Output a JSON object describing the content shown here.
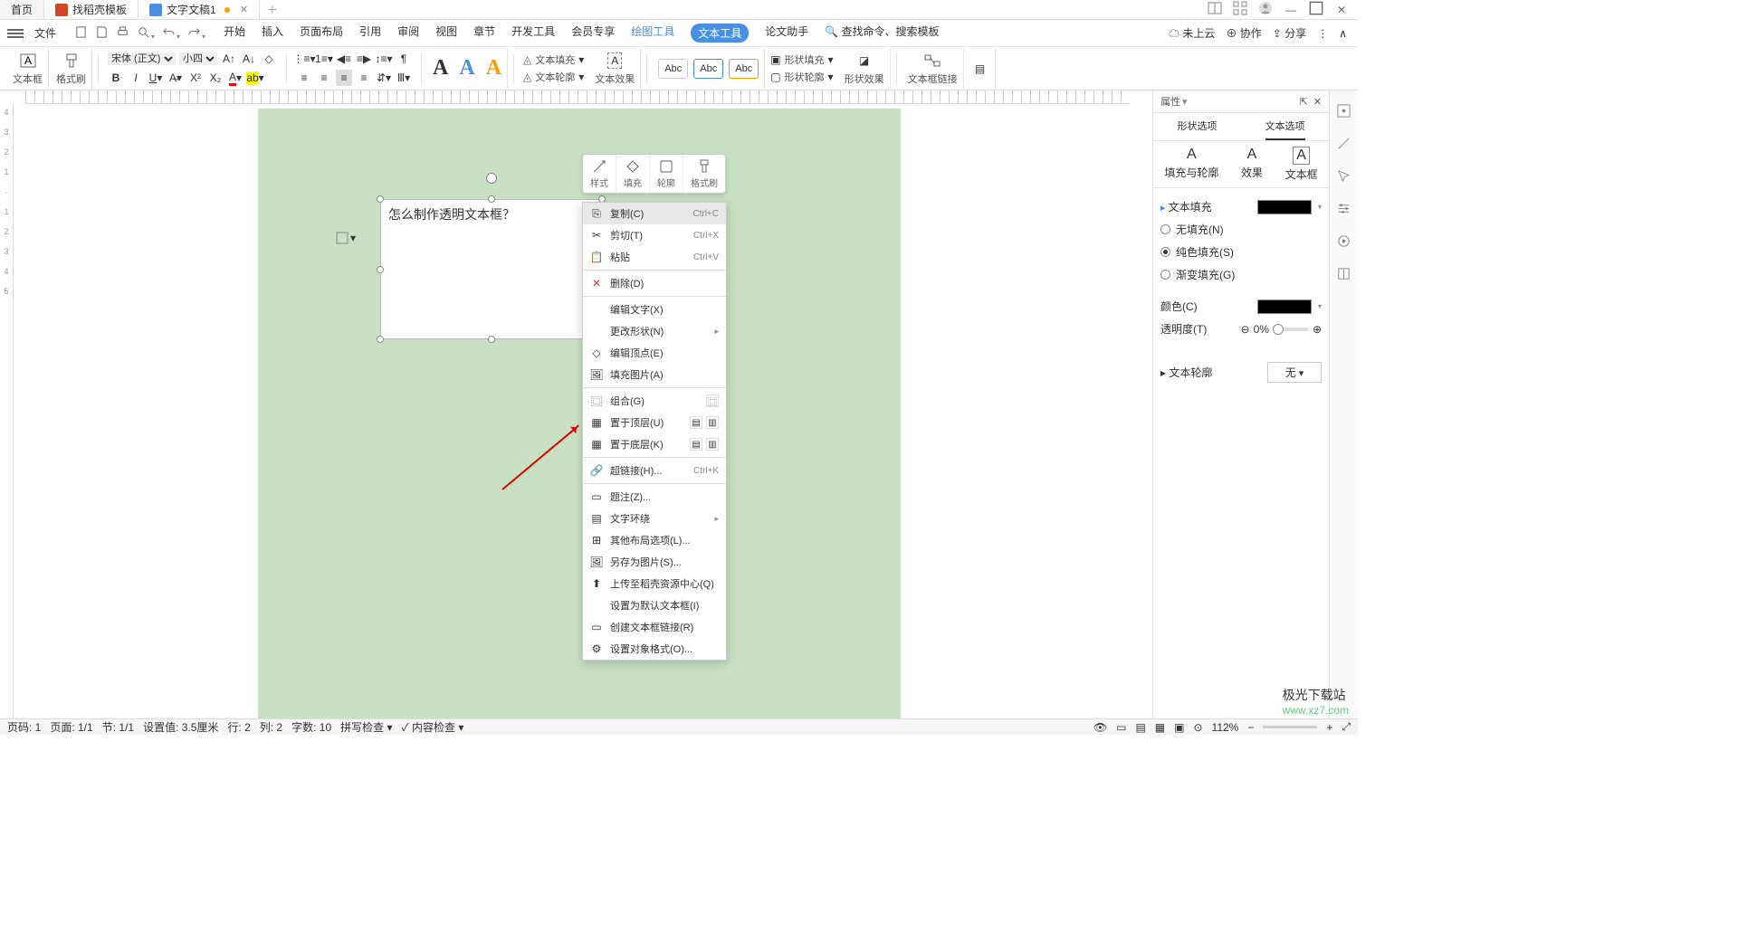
{
  "tabs": {
    "home": "首页",
    "docker": "找稻壳模板",
    "doc": "文字文稿1"
  },
  "menu": {
    "file": "文件",
    "items": [
      "开始",
      "插入",
      "页面布局",
      "引用",
      "审阅",
      "视图",
      "章节",
      "开发工具",
      "会员专享"
    ],
    "draw": "绘图工具",
    "text": "文本工具",
    "paper": "论文助手",
    "searchCmd": "查找命令、搜索模板",
    "notCloud": "未上云",
    "collab": "协作",
    "share": "分享"
  },
  "ribbon": {
    "textbox": "文本框",
    "format": "格式刷",
    "font": "宋体 (正文)",
    "size": "小四",
    "textFill": "文本填充",
    "textOutline": "文本轮廓",
    "textEffects": "文本效果",
    "shapeFill": "形状填充",
    "shapeOutline": "形状轮廓",
    "shapeEffects": "形状效果",
    "textboxLink": "文本框链接"
  },
  "mini": {
    "style": "样式",
    "fill": "填充",
    "outline": "轮廓",
    "fmt": "格式刷"
  },
  "textbox": {
    "content": "怎么制作透明文本框？"
  },
  "context": {
    "copy": "复制(C)",
    "copyKey": "Ctrl+C",
    "cut": "剪切(T)",
    "cutKey": "Ctrl+X",
    "paste": "粘贴",
    "pasteKey": "Ctrl+V",
    "delete": "删除(D)",
    "editText": "编辑文字(X)",
    "changeShape": "更改形状(N)",
    "editPoints": "编辑顶点(E)",
    "fillPic": "填充图片(A)",
    "group": "组合(G)",
    "bringFront": "置于顶层(U)",
    "sendBack": "置于底层(K)",
    "hyperlink": "超链接(H)...",
    "hyperKey": "Ctrl+K",
    "note": "题注(Z)...",
    "textWrap": "文字环绕",
    "otherLayout": "其他布局选项(L)...",
    "saveAsPic": "另存为图片(S)...",
    "upload": "上传至稻壳资源中心(Q)",
    "setDefault": "设置为默认文本框(I)",
    "createLink": "创建文本框链接(R)",
    "setFormat": "设置对象格式(O)..."
  },
  "panel": {
    "title": "属性",
    "tab1": "形状选项",
    "tab2": "文本选项",
    "sub1": "填充与轮廓",
    "sub2": "效果",
    "sub3": "文本框",
    "textFill": "文本填充",
    "noFill": "无填充(N)",
    "solidFill": "纯色填充(S)",
    "gradFill": "渐变填充(G)",
    "color": "颜色(C)",
    "opacity": "透明度(T)",
    "opVal": "0%",
    "textOutline": "文本轮廓",
    "none": "无"
  },
  "status": {
    "p1": "页码: 1",
    "p2": "页面: 1/1",
    "sec": "节: 1/1",
    "pos": "设置值: 3.5厘米",
    "row": "行: 2",
    "col": "列: 2",
    "words": "字数: 10",
    "spell": "拼写检查",
    "content": "内容检查",
    "zoom": "112%"
  },
  "watermark": {
    "t1": "极光下载站",
    "t2": "www.xz7.com"
  }
}
